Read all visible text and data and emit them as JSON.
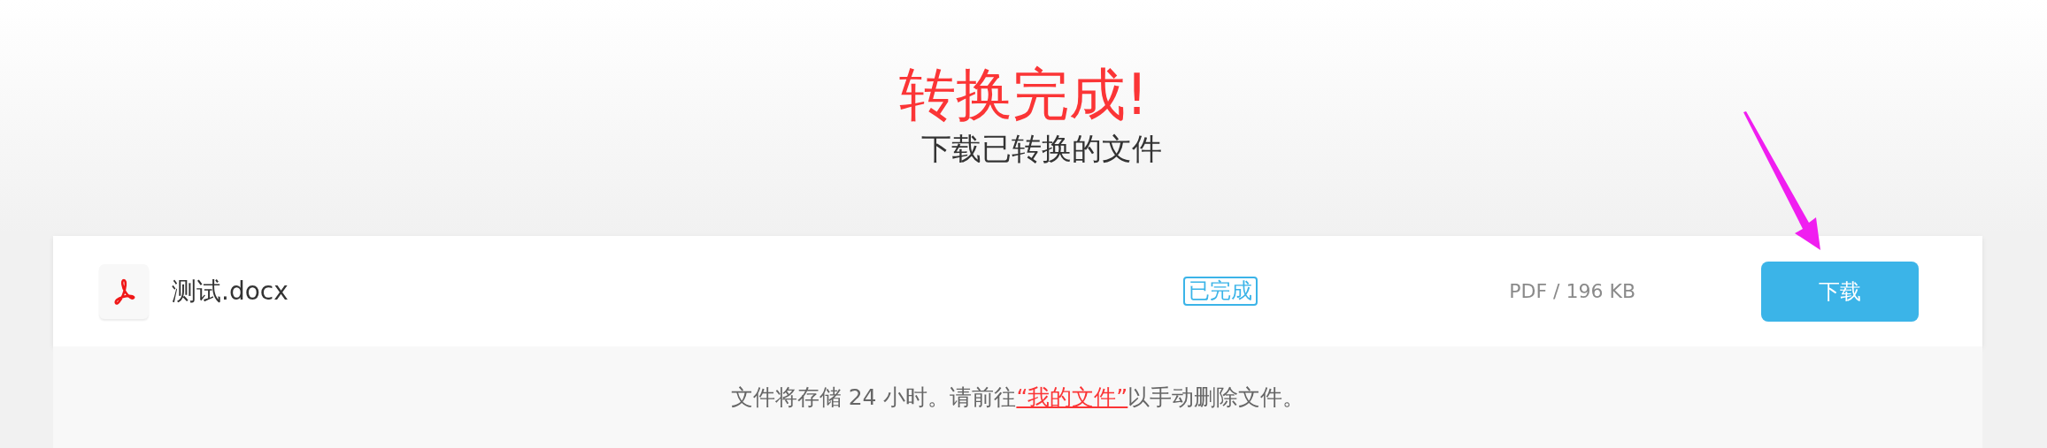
{
  "header": {
    "title": "转换完成!",
    "subtitle": "下载已转换的文件"
  },
  "files": [
    {
      "name": "测试.docx",
      "status": "已完成",
      "info": "PDF / 196 KB",
      "button": "下载"
    }
  ],
  "footer": {
    "before": "文件将存储 24 小时。请前往",
    "link": "“我的文件”",
    "after": "以手动删除文件。"
  }
}
